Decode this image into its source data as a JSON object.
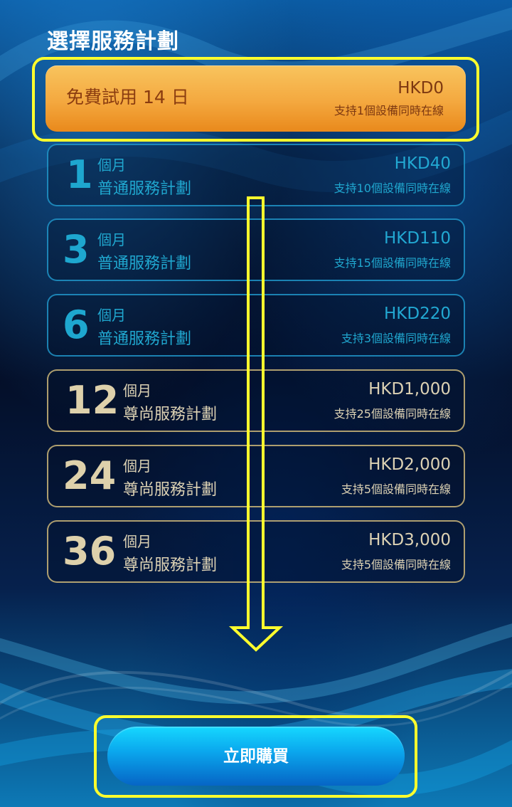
{
  "page": {
    "title": "選擇服務計劃"
  },
  "trial_plan": {
    "label": "免費試用 14 日",
    "price": "HKD0",
    "devices": "支持1個設備同時在線"
  },
  "plans": [
    {
      "months": "1",
      "unit": "個月",
      "type": "普通服務計劃",
      "price": "HKD40",
      "devices": "支持10個設備同時在線"
    },
    {
      "months": "3",
      "unit": "個月",
      "type": "普通服務計劃",
      "price": "HKD110",
      "devices": "支持15個設備同時在線"
    },
    {
      "months": "6",
      "unit": "個月",
      "type": "普通服務計劃",
      "price": "HKD220",
      "devices": "支持3個設備同時在線"
    },
    {
      "months": "12",
      "unit": "個月",
      "type": "尊尚服務計劃",
      "price": "HKD1,000",
      "devices": "支持25個設備同時在線"
    },
    {
      "months": "24",
      "unit": "個月",
      "type": "尊尚服務計劃",
      "price": "HKD2,000",
      "devices": "支持5個設備同時在線"
    },
    {
      "months": "36",
      "unit": "個月",
      "type": "尊尚服務計劃",
      "price": "HKD3,000",
      "devices": "支持5個設備同時在線"
    }
  ],
  "buy_button": {
    "label": "立即購買"
  },
  "colors": {
    "standard_plan": "#1ea7cf",
    "premium_plan": "#ddd2b4",
    "trial_background": "#f4a83f",
    "highlight": "#ffff2d",
    "button": "#0aa6ed"
  },
  "icons": {
    "scroll_direction": "down-arrow-icon"
  }
}
